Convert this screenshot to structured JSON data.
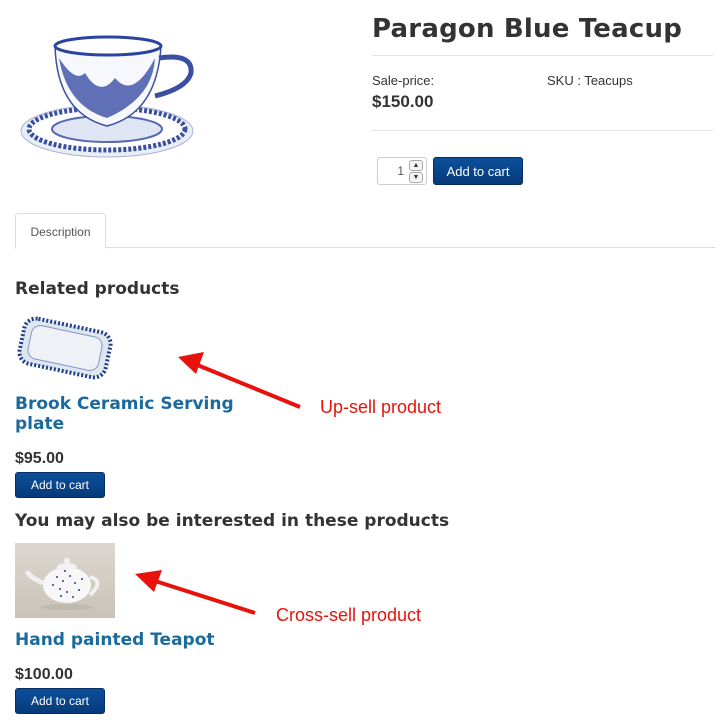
{
  "product": {
    "title": "Paragon Blue Teacup",
    "price_label": "Sale-price:",
    "price": "$150.00",
    "sku": "SKU : Teacups",
    "quantity": "1",
    "add_to_cart": "Add to cart",
    "image_icon": "teacup-image"
  },
  "tabs": [
    {
      "label": "Description",
      "active": true
    }
  ],
  "related": {
    "heading": "Related products",
    "product": {
      "name": "Brook Ceramic Serving plate",
      "price": "$95.00",
      "add_to_cart": "Add to cart"
    }
  },
  "cross_sell": {
    "heading": "You may also be interested in these products",
    "product": {
      "name": "Hand painted Teapot",
      "price": "$100.00",
      "add_to_cart": "Add to cart"
    }
  },
  "annotations": {
    "upsell": "Up-sell product",
    "crosssell": "Cross-sell product",
    "color": "#e8120c"
  },
  "colors": {
    "button": "#0d4f9c",
    "link": "#1b6a9c"
  }
}
